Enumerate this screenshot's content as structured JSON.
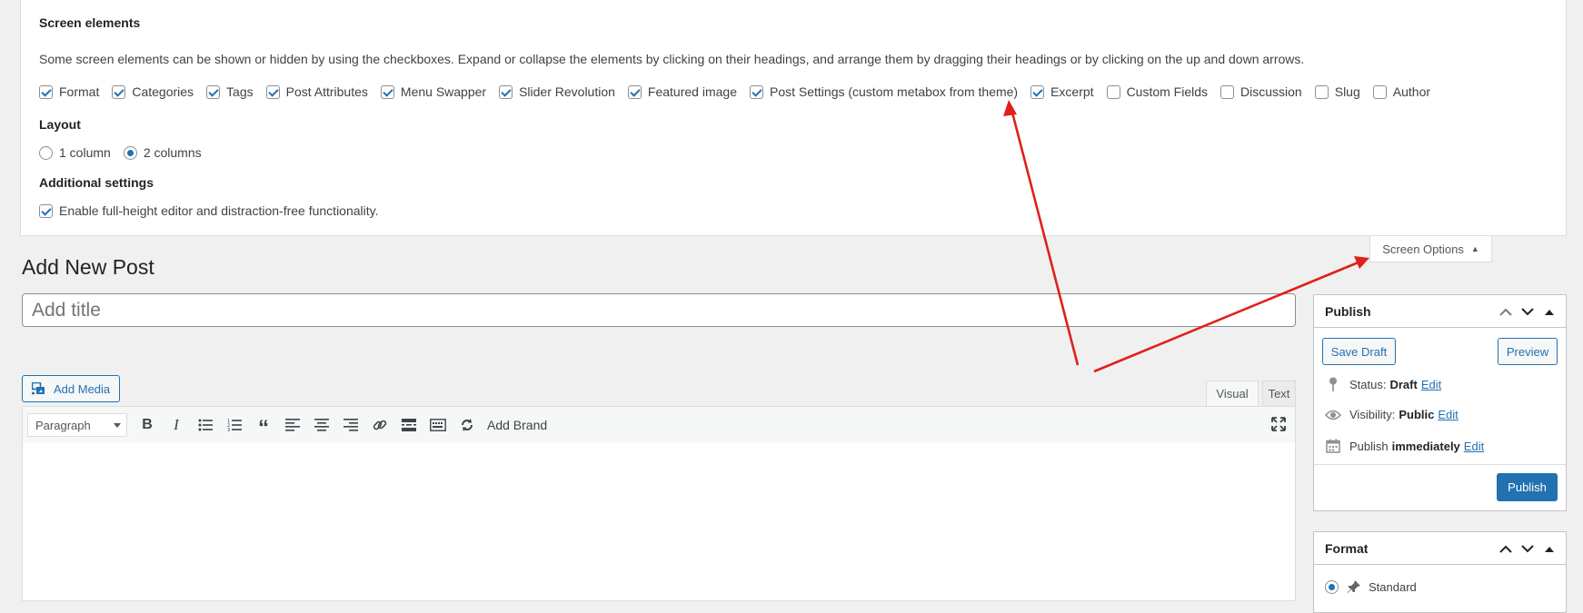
{
  "screen_options": {
    "title": "Screen elements",
    "description": "Some screen elements can be shown or hidden by using the checkboxes. Expand or collapse the elements by clicking on their headings, and arrange them by dragging their headings or by clicking on the up and down arrows.",
    "elements": [
      {
        "label": "Format",
        "checked": true
      },
      {
        "label": "Categories",
        "checked": true
      },
      {
        "label": "Tags",
        "checked": true
      },
      {
        "label": "Post Attributes",
        "checked": true
      },
      {
        "label": "Menu Swapper",
        "checked": true
      },
      {
        "label": "Slider Revolution",
        "checked": true
      },
      {
        "label": "Featured image",
        "checked": true
      },
      {
        "label": "Post Settings (custom metabox from theme)",
        "checked": true
      },
      {
        "label": "Excerpt",
        "checked": true
      },
      {
        "label": "Custom Fields",
        "checked": false
      },
      {
        "label": "Discussion",
        "checked": false
      },
      {
        "label": "Slug",
        "checked": false
      },
      {
        "label": "Author",
        "checked": false
      }
    ],
    "layout_heading": "Layout",
    "layout_options": [
      {
        "label": "1 column",
        "checked": false
      },
      {
        "label": "2 columns",
        "checked": true
      }
    ],
    "additional_heading": "Additional settings",
    "fullheight_label": "Enable full-height editor and distraction-free functionality.",
    "fullheight_checked": true,
    "tab_label": "Screen Options"
  },
  "page": {
    "title": "Add New Post",
    "title_placeholder": "Add title"
  },
  "editor": {
    "add_media": "Add Media",
    "tab_visual": "Visual",
    "tab_text": "Text",
    "paragraph_select": "Paragraph",
    "add_brand": "Add Brand"
  },
  "publish_box": {
    "title": "Publish",
    "save_draft": "Save Draft",
    "preview": "Preview",
    "status_label": "Status:",
    "status_value": "Draft",
    "visibility_label": "Visibility:",
    "visibility_value": "Public",
    "publish_label": "Publish",
    "publish_value": "immediately",
    "edit": "Edit",
    "publish_button": "Publish"
  },
  "format_box": {
    "title": "Format",
    "option": "Standard"
  },
  "colors": {
    "accent": "#2271b1",
    "annotation_arrow": "#e0201b"
  }
}
